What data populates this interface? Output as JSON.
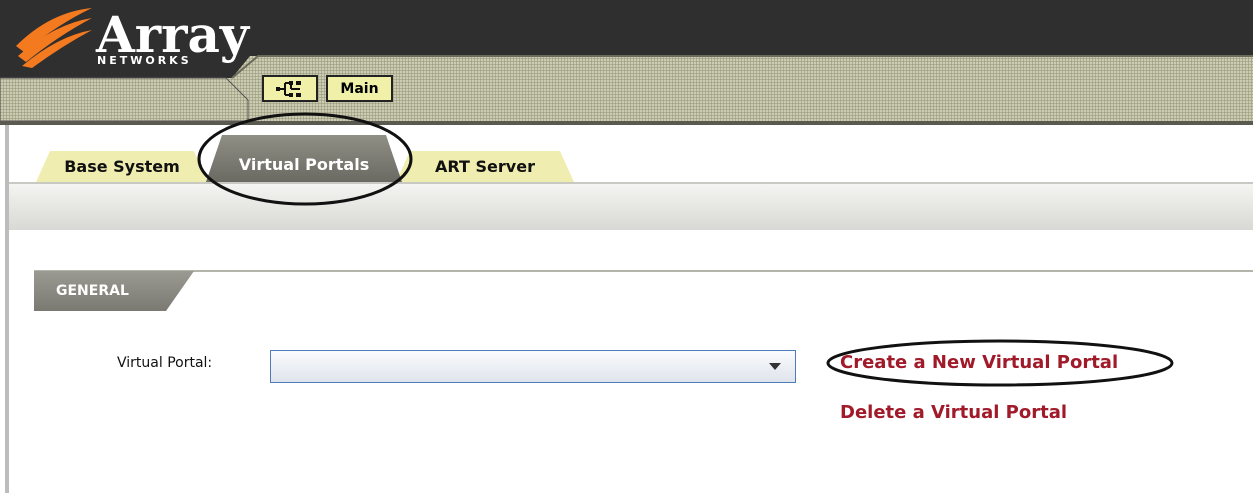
{
  "logo": {
    "name": "Array",
    "sub": "NETWORKS"
  },
  "toolbar": {
    "tree_icon": "tree-hierarchy-icon",
    "main_label": "Main"
  },
  "tabs": [
    {
      "label": "Base System",
      "active": false
    },
    {
      "label": "Virtual Portals",
      "active": true
    },
    {
      "label": "ART Server",
      "active": false
    }
  ],
  "section": {
    "title": "GENERAL"
  },
  "form": {
    "virtual_portal_label": "Virtual Portal:",
    "virtual_portal_value": ""
  },
  "links": {
    "create": "Create a New Virtual Portal",
    "delete": "Delete a Virtual Portal"
  },
  "colors": {
    "header_dark": "#2f2f2f",
    "logo_orange": "#f47a20",
    "tab_bg": "#f0edb0",
    "tab_active": "#7a7a72",
    "link": "#a11a2a",
    "annotation": "#111111"
  }
}
